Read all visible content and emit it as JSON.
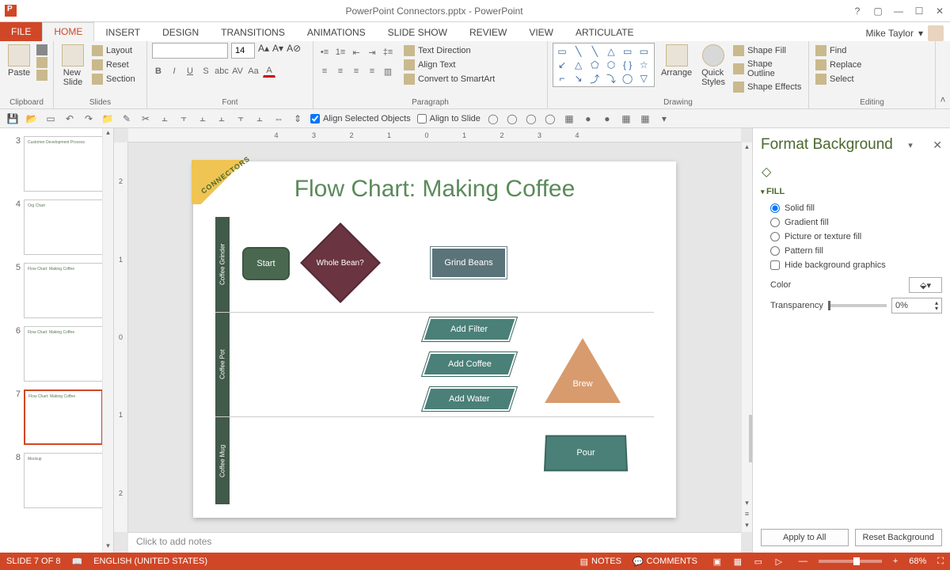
{
  "app": {
    "title": "PowerPoint Connectors.pptx - PowerPoint",
    "user": "Mike Taylor"
  },
  "tabs": {
    "file": "FILE",
    "home": "HOME",
    "insert": "INSERT",
    "design": "DESIGN",
    "transitions": "TRANSITIONS",
    "animations": "ANIMATIONS",
    "slideshow": "SLIDE SHOW",
    "review": "REVIEW",
    "view": "VIEW",
    "articulate": "ARTICULATE"
  },
  "ribbon": {
    "clipboard": {
      "label": "Clipboard",
      "paste": "Paste"
    },
    "slides": {
      "label": "Slides",
      "new_slide": "New\nSlide",
      "layout": "Layout",
      "reset": "Reset",
      "section": "Section"
    },
    "font": {
      "label": "Font",
      "size": "14"
    },
    "paragraph": {
      "label": "Paragraph",
      "text_direction": "Text Direction",
      "align_text": "Align Text",
      "convert_smartart": "Convert to SmartArt"
    },
    "drawing": {
      "label": "Drawing",
      "arrange": "Arrange",
      "quick_styles": "Quick\nStyles",
      "shape_fill": "Shape Fill",
      "shape_outline": "Shape Outline",
      "shape_effects": "Shape Effects"
    },
    "editing": {
      "label": "Editing",
      "find": "Find",
      "replace": "Replace",
      "select": "Select"
    }
  },
  "qat2": {
    "align_selected": "Align Selected Objects",
    "align_slide": "Align to Slide"
  },
  "slides_list": [
    {
      "num": "3",
      "caption": "Customer Development Process"
    },
    {
      "num": "4",
      "caption": "Org Chart"
    },
    {
      "num": "5",
      "caption": "Flow Chart: Making Coffee"
    },
    {
      "num": "6",
      "caption": "Flow Chart: Making Coffee"
    },
    {
      "num": "7",
      "caption": "Flow Chart: Making Coffee"
    },
    {
      "num": "8",
      "caption": "Mockup"
    }
  ],
  "slide": {
    "banner": "CONNECTORS",
    "title": "Flow Chart: Making Coffee",
    "lanes": [
      "Coffee Grinder",
      "Coffee Pot",
      "Coffee Mug"
    ],
    "shapes": {
      "start": "Start",
      "decision": "Whole Bean?",
      "grind": "Grind Beans",
      "filter": "Add Filter",
      "coffee": "Add Coffee",
      "water": "Add Water",
      "brew": "Brew",
      "pour": "Pour"
    },
    "notes_placeholder": "Click to add notes"
  },
  "ruler_marks_h": "4 3 2 1 0 1 2 3 4",
  "ruler_marks_v": [
    "2",
    "1",
    "0",
    "1",
    "2"
  ],
  "format_pane": {
    "title": "Format Background",
    "section": "FILL",
    "solid": "Solid fill",
    "gradient": "Gradient fill",
    "picture": "Picture or texture fill",
    "pattern": "Pattern fill",
    "hide_bg": "Hide background graphics",
    "color_label": "Color",
    "transparency_label": "Transparency",
    "transparency_value": "0%",
    "apply_all": "Apply to All",
    "reset": "Reset Background"
  },
  "status": {
    "slide_pos": "SLIDE 7 OF 8",
    "lang": "ENGLISH (UNITED STATES)",
    "notes": "NOTES",
    "comments": "COMMENTS",
    "zoom": "68%"
  }
}
